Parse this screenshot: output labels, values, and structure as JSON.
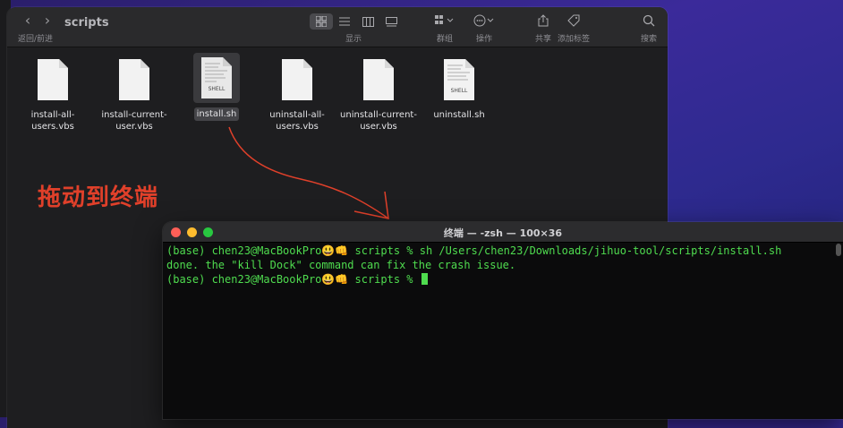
{
  "finder": {
    "title": "scripts",
    "nav_caption": "返回/前进",
    "view_caption": "显示",
    "group_caption": "群组",
    "action_caption": "操作",
    "share_caption": "共享",
    "tag_caption": "添加标签",
    "search_caption": "搜索",
    "files": [
      {
        "name": "install-all-\nusers.vbs",
        "type": "vbs"
      },
      {
        "name": "install-current-\nuser.vbs",
        "type": "vbs"
      },
      {
        "name": "install.sh",
        "type": "shell",
        "selected": true,
        "badge": "SHELL"
      },
      {
        "name": "uninstall-all-\nusers.vbs",
        "type": "vbs"
      },
      {
        "name": "uninstall-current-\nuser.vbs",
        "type": "vbs"
      },
      {
        "name": "uninstall.sh",
        "type": "shell",
        "badge": "SHELL"
      }
    ]
  },
  "annotation": {
    "text": "拖动到终端",
    "color": "#e0402a"
  },
  "terminal": {
    "title": "终端 — -zsh — 100×36",
    "lines": [
      "(base) chen23@MacBookPro😃👊 scripts % sh /Users/chen23/Downloads/jihuo-tool/scripts/install.sh",
      "done. the \"kill Dock\" command can fix the crash issue.",
      "(base) chen23@MacBookPro😃👊 scripts % "
    ],
    "text_color": "#4fdc4f",
    "lights": {
      "close": "#ff5f57",
      "minimize": "#febc2e",
      "zoom": "#28c840"
    }
  }
}
